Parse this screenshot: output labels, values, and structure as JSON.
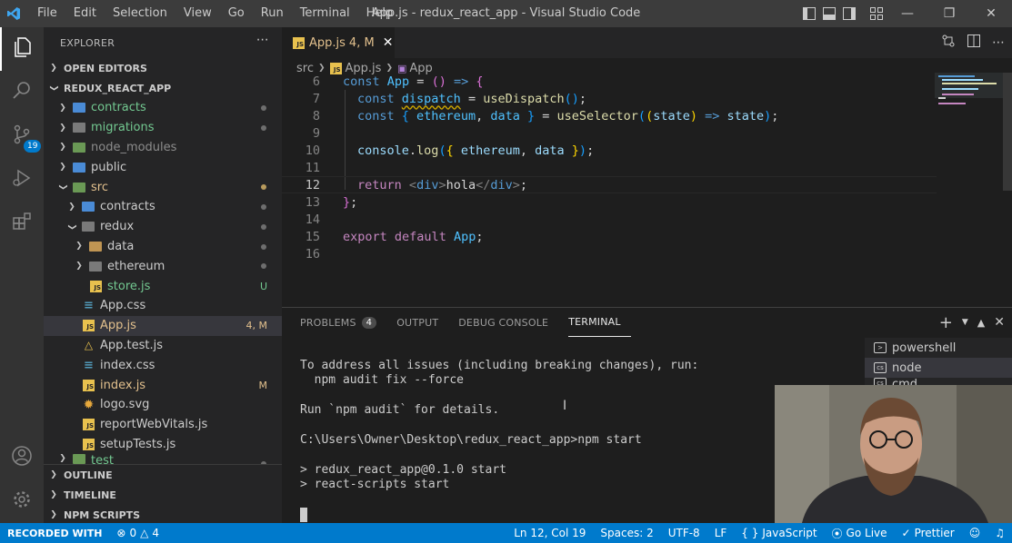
{
  "window": {
    "title": "App.js - redux_react_app - Visual Studio Code",
    "menu": [
      "File",
      "Edit",
      "Selection",
      "View",
      "Go",
      "Run",
      "Terminal",
      "Help"
    ]
  },
  "activity": {
    "source_control_badge": "19"
  },
  "explorer": {
    "header": "EXPLORER",
    "open_editors": "OPEN EDITORS",
    "project": "REDUX_REACT_APP",
    "items": [
      {
        "label": "contracts",
        "status": ""
      },
      {
        "label": "migrations",
        "status": ""
      },
      {
        "label": "node_modules",
        "status": ""
      },
      {
        "label": "public",
        "status": ""
      },
      {
        "label": "src",
        "status": ""
      },
      {
        "label": "contracts",
        "status": ""
      },
      {
        "label": "redux",
        "status": ""
      },
      {
        "label": "data",
        "status": ""
      },
      {
        "label": "ethereum",
        "status": ""
      },
      {
        "label": "store.js",
        "status": "U"
      },
      {
        "label": "App.css",
        "status": ""
      },
      {
        "label": "App.js",
        "status": "4, M"
      },
      {
        "label": "App.test.js",
        "status": ""
      },
      {
        "label": "index.css",
        "status": ""
      },
      {
        "label": "index.js",
        "status": "M"
      },
      {
        "label": "logo.svg",
        "status": ""
      },
      {
        "label": "reportWebVitals.js",
        "status": ""
      },
      {
        "label": "setupTests.js",
        "status": ""
      },
      {
        "label": "test",
        "status": ""
      }
    ],
    "outline": "OUTLINE",
    "timeline": "TIMELINE",
    "npm_scripts": "NPM SCRIPTS"
  },
  "editor": {
    "tab_label": "App.js",
    "tab_status": "4, M",
    "breadcrumb": [
      "src",
      "App.js",
      "App"
    ],
    "line_numbers": [
      "6",
      "7",
      "8",
      "9",
      "10",
      "11",
      "12",
      "13",
      "14",
      "15",
      "16"
    ],
    "tokens": {
      "const": "const",
      "App": "App",
      "eq": " = ",
      "paren_open": "(",
      "paren_close": ")",
      "arrow": " => ",
      "brace_open": "{",
      "brace_close": "}",
      "dispatch": "dispatch",
      "useDispatch": "useDispatch",
      "semicolon": ";",
      "ethereum": "ethereum",
      "comma": ", ",
      "data": "data",
      "useSelector": "useSelector",
      "state": "state",
      "console": "console",
      "dot": ".",
      "log": "log",
      "return": "return",
      "lt": "<",
      "div": "div",
      "gt": ">",
      "hola": "hola",
      "close_lt": "</",
      "export": "export",
      "default": "default",
      "sp": " ",
      "brace_sp_open": "{ ",
      "brace_sp_close": " }"
    }
  },
  "panel": {
    "tabs": [
      "PROBLEMS",
      "OUTPUT",
      "DEBUG CONSOLE",
      "TERMINAL"
    ],
    "problems_count": "4",
    "terminal_lines": [
      "To address all issues (including breaking changes), run:",
      "  npm audit fix --force",
      "",
      "Run `npm audit` for details.",
      "",
      "C:\\Users\\Owner\\Desktop\\redux_react_app>npm start",
      "",
      "> redux_react_app@0.1.0 start",
      "> react-scripts start"
    ],
    "terminal_list": [
      "powershell",
      "node",
      "cmd"
    ]
  },
  "status": {
    "recording": "RECORDED WITH",
    "errors": "0",
    "warnings": "4",
    "position": "Ln 12, Col 19",
    "spaces": "Spaces: 2",
    "encoding": "UTF-8",
    "eol": "LF",
    "language": "JavaScript",
    "golive": "Go Live",
    "prettier": "Prettier"
  },
  "colors": {
    "accent": "#007acc",
    "modified": "#e2c08d",
    "untracked": "#73c991"
  }
}
